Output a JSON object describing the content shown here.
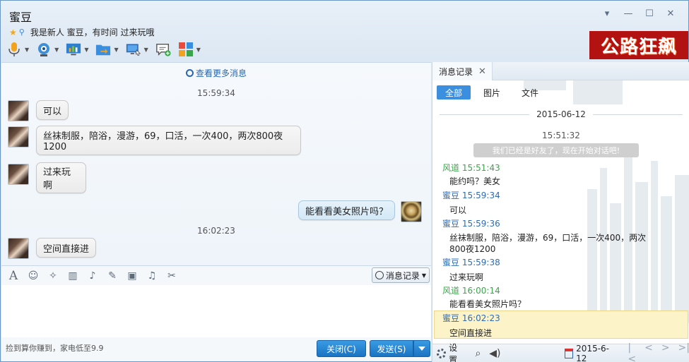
{
  "window": {
    "title": "蜜豆",
    "signature": "我是新人 蜜豆，有时间 过来玩哦",
    "banner_text": "公路狂飙"
  },
  "toolbar": {
    "icons": [
      "microphone-icon",
      "webcam-icon",
      "screen-share-icon",
      "file-transfer-icon",
      "remote-desktop-icon",
      "message-add-icon",
      "apps-icon"
    ]
  },
  "chat": {
    "more_messages": "查看更多消息",
    "messages": [
      {
        "time": "15:59:34"
      },
      {
        "from": "other",
        "text": "可以"
      },
      {
        "from": "other",
        "text": "丝袜制服，陪浴，漫游，69，口活，一次400，两次800夜1200"
      },
      {
        "from": "other",
        "text": "过来玩啊"
      },
      {
        "from": "me",
        "text": "能看看美女照片吗？"
      },
      {
        "time": "16:02:23"
      },
      {
        "from": "other",
        "text": "空间直接进"
      }
    ],
    "ts1": "15:59:34",
    "ts2": "16:02:23",
    "m1": "可以",
    "m2": "丝袜制服，陪浴，漫游，69，口活，一次400，两次800夜1200",
    "m3": "过来玩啊",
    "m4": "能看看美女照片吗？",
    "m5": "空间直接进"
  },
  "input": {
    "history_button": "消息记录",
    "ad_text": "捡到算你赚到，家电低至9.9",
    "close_button": "关闭(C)",
    "send_button": "发送(S)"
  },
  "history": {
    "tab_label": "消息记录",
    "filters": [
      "全部",
      "图片",
      "文件"
    ],
    "date": "2015-06-12",
    "first_time": "15:51:32",
    "system_message": "我们已经是好友了，现在开始对话吧!",
    "entries": [
      {
        "sender": "风道",
        "time": "15:51:43",
        "text": "能约吗？美女",
        "mine": true
      },
      {
        "sender": "蜜豆",
        "time": "15:59:34",
        "text": "可以",
        "mine": false
      },
      {
        "sender": "蜜豆",
        "time": "15:59:36",
        "text": "丝袜制服，陪浴，漫游，69，口活，一次400，两次800夜1200",
        "mine": false
      },
      {
        "sender": "蜜豆",
        "time": "15:59:38",
        "text": "过来玩啊",
        "mine": false
      },
      {
        "sender": "风道",
        "time": "16:00:14",
        "text": "能看看美女照片吗？",
        "mine": true
      },
      {
        "sender": "蜜豆",
        "time": "16:02:23",
        "text": "空间直接进",
        "mine": false
      }
    ],
    "h0": "风道 15:51:43",
    "h0m": "能约吗？美女",
    "h1": "蜜豆 15:59:34",
    "h1m": "可以",
    "h2": "蜜豆 15:59:36",
    "h2m": "丝袜制服，陪浴，漫游，69，口活，一次400，两次800夜1200",
    "h3": "蜜豆 15:59:38",
    "h3m": "过来玩啊",
    "h4": "风道 16:00:14",
    "h4m": "能看看美女照片吗？",
    "h5": "蜜豆 16:02:23",
    "h5m": "空间直接进",
    "settings_label": "设置",
    "footer_date": "2015-6-12"
  },
  "colors": {
    "accent": "#3c8fde",
    "other_name": "#2d6cb5",
    "my_name": "#3aa64a",
    "banner": "#b31212"
  }
}
